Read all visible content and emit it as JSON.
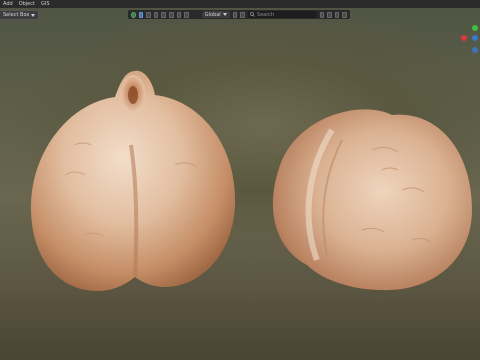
{
  "menu": {
    "items": [
      "Add",
      "Object",
      "GIS"
    ]
  },
  "select_mode": {
    "label": "Select Box"
  },
  "header": {
    "pivot_label": "Global",
    "search_placeholder": "Search"
  },
  "colors": {
    "accent": "#4772b3",
    "gizmo_x": "#d63a3a",
    "gizmo_y": "#3fbf3f",
    "gizmo_z": "#3a78d6"
  }
}
